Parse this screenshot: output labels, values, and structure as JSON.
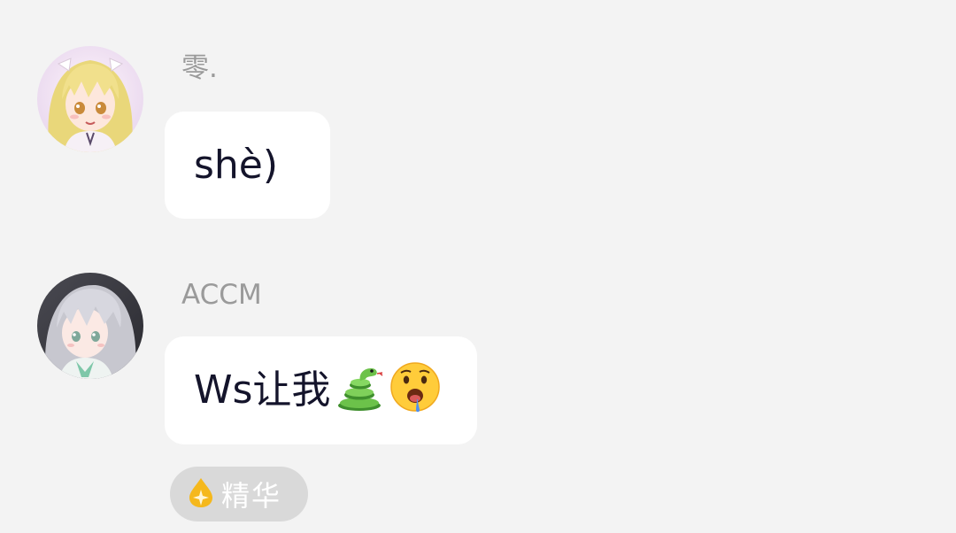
{
  "messages": [
    {
      "sender": "零.",
      "text": "shè)",
      "avatar_icon": "anime-girl-blonde-avatar"
    },
    {
      "sender": "ACCM",
      "text": "Ws让我",
      "emojis": [
        "snake-emoji",
        "drooling-face-emoji"
      ],
      "avatar_icon": "anime-girl-silver-hair-avatar",
      "badge": {
        "label": "精华",
        "icon": "flame-drop-icon",
        "color": "#f5b81c"
      }
    }
  ],
  "colors": {
    "background": "#f3f3f3",
    "bubble": "#ffffff",
    "sender": "#9a9a9a",
    "text": "#14142b",
    "badge_bg": "#d9d9d9"
  }
}
